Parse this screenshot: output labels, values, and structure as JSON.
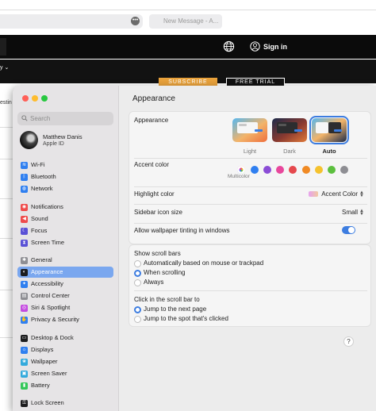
{
  "browser": {
    "url_more": "•••",
    "tab_title": "New Message - A...",
    "nav": {
      "sign_in": "Sign in",
      "caret": "y ⌄"
    },
    "subscribe": "SUBSCRIBE",
    "free_trial": "FREE TRIAL",
    "left_text": "estin"
  },
  "window": {
    "traffic_lights": {
      "close": "#ff5f57",
      "minimize": "#febc2e",
      "zoom": "#28c840"
    },
    "search": {
      "placeholder": "Search"
    },
    "profile": {
      "name": "Matthew Danis",
      "subtitle": "Apple ID"
    },
    "sidebar": [
      {
        "label": "Wi-Fi",
        "icon": "wifi-icon",
        "color": "#2f7ff0"
      },
      {
        "label": "Bluetooth",
        "icon": "bluetooth-icon",
        "color": "#2f7ff0"
      },
      {
        "label": "Network",
        "icon": "globe-icon",
        "color": "#2f7ff0"
      },
      {
        "label": "Notifications",
        "icon": "bell-icon",
        "color": "#ef4b4b"
      },
      {
        "label": "Sound",
        "icon": "speaker-icon",
        "color": "#ef4b4b"
      },
      {
        "label": "Focus",
        "icon": "moon-icon",
        "color": "#5a51d6"
      },
      {
        "label": "Screen Time",
        "icon": "hourglass-icon",
        "color": "#5a51d6"
      },
      {
        "label": "General",
        "icon": "gear-icon",
        "color": "#8e8e93"
      },
      {
        "label": "Appearance",
        "icon": "appearance-icon",
        "color": "#1c1c1e",
        "selected": true
      },
      {
        "label": "Accessibility",
        "icon": "accessibility-icon",
        "color": "#2f7ff0"
      },
      {
        "label": "Control Center",
        "icon": "control-center-icon",
        "color": "#8e8e93"
      },
      {
        "label": "Siri & Spotlight",
        "icon": "siri-icon",
        "color": "#c44be0"
      },
      {
        "label": "Privacy & Security",
        "icon": "hand-icon",
        "color": "#2f7ff0"
      },
      {
        "label": "Desktop & Dock",
        "icon": "dock-icon",
        "color": "#1c1c1e"
      },
      {
        "label": "Displays",
        "icon": "display-icon",
        "color": "#2f7ff0"
      },
      {
        "label": "Wallpaper",
        "icon": "wallpaper-icon",
        "color": "#34aadc"
      },
      {
        "label": "Screen Saver",
        "icon": "screensaver-icon",
        "color": "#34aadc"
      },
      {
        "label": "Battery",
        "icon": "battery-icon",
        "color": "#34c759"
      },
      {
        "label": "Lock Screen",
        "icon": "lock-icon",
        "color": "#1c1c1e"
      }
    ],
    "content": {
      "title": "Appearance",
      "appearance": {
        "label": "Appearance",
        "options": [
          {
            "label": "Light",
            "selected": false
          },
          {
            "label": "Dark",
            "selected": false
          },
          {
            "label": "Auto",
            "selected": true
          }
        ]
      },
      "accent": {
        "label": "Accent color",
        "selected_name": "Multicolor",
        "colors": [
          "#c44be0",
          "#2f7ff0",
          "#8b4dd6",
          "#e8479c",
          "#e5484d",
          "#f08a24",
          "#f5c22e",
          "#5cbf3e",
          "#8e8e93"
        ]
      },
      "highlight": {
        "label": "Highlight color",
        "value": "Accent Color"
      },
      "sidebar_icon_size": {
        "label": "Sidebar icon size",
        "value": "Small"
      },
      "wallpaper_tinting": {
        "label": "Allow wallpaper tinting in windows",
        "on": true
      },
      "scroll_bars": {
        "label": "Show scroll bars",
        "options": [
          {
            "label": "Automatically based on mouse or trackpad",
            "selected": false
          },
          {
            "label": "When scrolling",
            "selected": true
          },
          {
            "label": "Always",
            "selected": false
          }
        ]
      },
      "click_scroll": {
        "label": "Click in the scroll bar to",
        "options": [
          {
            "label": "Jump to the next page",
            "selected": true
          },
          {
            "label": "Jump to the spot that's clicked",
            "selected": false
          }
        ]
      },
      "help": "?"
    }
  }
}
